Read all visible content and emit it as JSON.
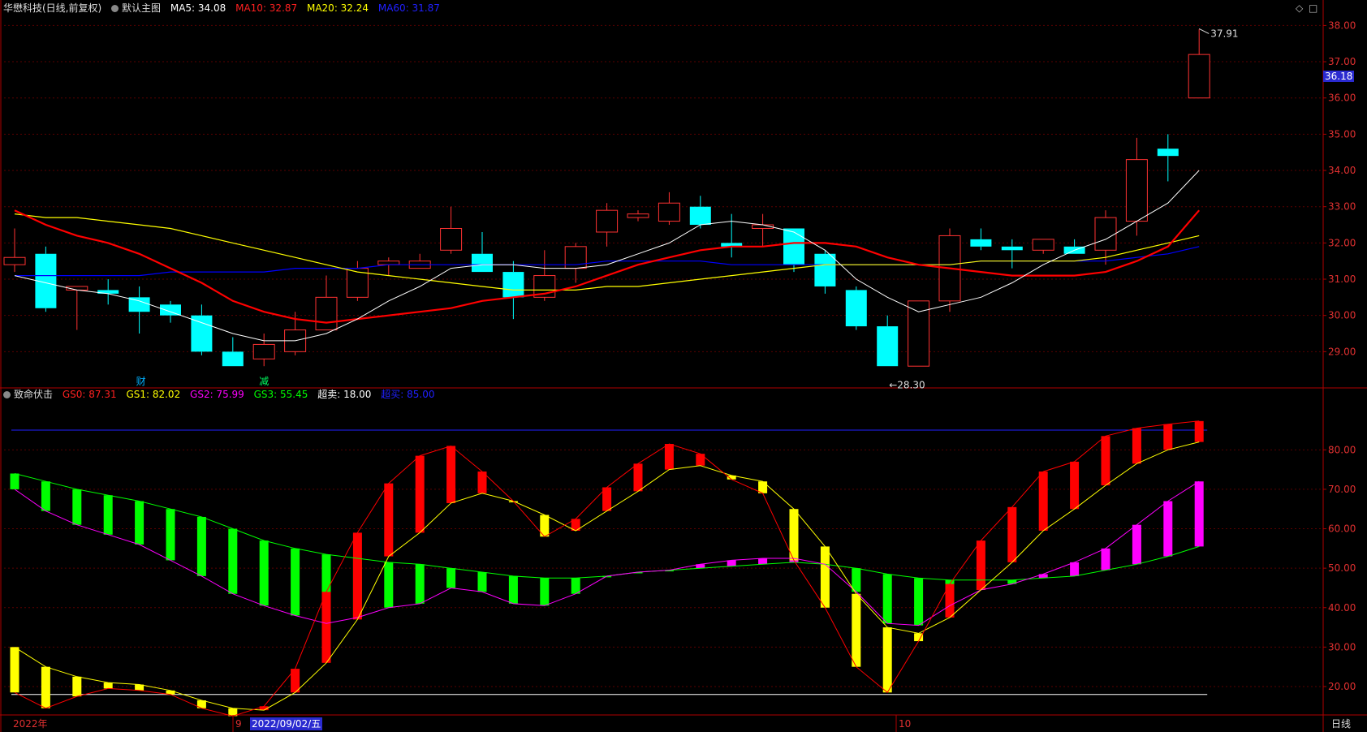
{
  "main_header": {
    "title": "华懋科技(日线,前复权)",
    "chart_name": "默认主图",
    "ma5_label": "MA5: 34.08",
    "ma10_label": "MA10: 32.87",
    "ma20_label": "MA20: 32.24",
    "ma60_label": "MA60: 31.87"
  },
  "sub_header": {
    "name": "致命伏击",
    "gs0_label": "GS0: 87.31",
    "gs1_label": "GS1: 82.02",
    "gs2_label": "GS2: 75.99",
    "gs3_label": "GS3: 55.45",
    "oversold_label": "超卖: 18.00",
    "overbought_label": "超买: 85.00"
  },
  "colors": {
    "up": "#ff3232",
    "down": "#00ffff",
    "ma5": "#ffffff",
    "ma10": "#ff0000",
    "ma20": "#ffff00",
    "ma60": "#0000ff",
    "gs_red": "#ff0000",
    "gs_yellow": "#ffff00",
    "gs_green": "#00ff00",
    "gs_magenta": "#ff00ff",
    "axis": "#b00000"
  },
  "annotations": {
    "high_label": "37.91",
    "low_label": "28.30",
    "current_price": "36.18",
    "event1": "财",
    "event2": "减"
  },
  "time_axis": {
    "year_label": "2022年",
    "sep_label": "9",
    "oct_label": "10",
    "cursor_date": "2022/09/02/五",
    "timeframe": "日线"
  },
  "chart_data": [
    {
      "type": "candlestick",
      "title": "华懋科技(日线,前复权)",
      "ylim": [
        28.0,
        38.3
      ],
      "y_ticks": [
        "29.00",
        "30.00",
        "31.00",
        "32.00",
        "33.00",
        "34.00",
        "35.00",
        "36.00",
        "37.00",
        "38.00"
      ],
      "candles": [
        {
          "o": 31.4,
          "h": 32.4,
          "l": 31.2,
          "c": 31.6
        },
        {
          "o": 31.7,
          "h": 31.9,
          "l": 30.1,
          "c": 30.2
        },
        {
          "o": 30.7,
          "h": 30.8,
          "l": 29.6,
          "c": 30.8
        },
        {
          "o": 30.7,
          "h": 31.0,
          "l": 30.3,
          "c": 30.6
        },
        {
          "o": 30.5,
          "h": 30.8,
          "l": 29.5,
          "c": 30.1
        },
        {
          "o": 30.3,
          "h": 30.4,
          "l": 29.8,
          "c": 30.0
        },
        {
          "o": 30.0,
          "h": 30.3,
          "l": 28.9,
          "c": 29.0
        },
        {
          "o": 29.0,
          "h": 29.4,
          "l": 28.6,
          "c": 28.6
        },
        {
          "o": 28.8,
          "h": 29.5,
          "l": 28.6,
          "c": 29.2
        },
        {
          "o": 29.0,
          "h": 30.1,
          "l": 28.9,
          "c": 29.6
        },
        {
          "o": 29.6,
          "h": 31.1,
          "l": 29.6,
          "c": 30.5
        },
        {
          "o": 30.5,
          "h": 31.5,
          "l": 30.4,
          "c": 31.3
        },
        {
          "o": 31.4,
          "h": 31.6,
          "l": 31.1,
          "c": 31.5
        },
        {
          "o": 31.3,
          "h": 31.7,
          "l": 31.3,
          "c": 31.5
        },
        {
          "o": 31.8,
          "h": 33.0,
          "l": 31.7,
          "c": 32.4
        },
        {
          "o": 31.7,
          "h": 32.3,
          "l": 31.2,
          "c": 31.2
        },
        {
          "o": 31.2,
          "h": 31.5,
          "l": 29.9,
          "c": 30.5
        },
        {
          "o": 30.5,
          "h": 31.8,
          "l": 30.4,
          "c": 31.1
        },
        {
          "o": 31.3,
          "h": 32.0,
          "l": 30.9,
          "c": 31.9
        },
        {
          "o": 32.3,
          "h": 33.1,
          "l": 31.9,
          "c": 32.9
        },
        {
          "o": 32.7,
          "h": 32.9,
          "l": 32.6,
          "c": 32.8
        },
        {
          "o": 32.6,
          "h": 33.4,
          "l": 32.5,
          "c": 33.1
        },
        {
          "o": 33.0,
          "h": 33.3,
          "l": 32.4,
          "c": 32.5
        },
        {
          "o": 32.0,
          "h": 32.8,
          "l": 31.6,
          "c": 31.9
        },
        {
          "o": 32.4,
          "h": 32.8,
          "l": 31.9,
          "c": 32.5
        },
        {
          "o": 32.4,
          "h": 32.4,
          "l": 31.2,
          "c": 31.4
        },
        {
          "o": 31.7,
          "h": 31.8,
          "l": 30.6,
          "c": 30.8
        },
        {
          "o": 30.7,
          "h": 30.8,
          "l": 29.6,
          "c": 29.7
        },
        {
          "o": 29.7,
          "h": 30.0,
          "l": 28.6,
          "c": 28.6
        },
        {
          "o": 28.6,
          "h": 30.4,
          "l": 28.6,
          "c": 30.4
        },
        {
          "o": 30.4,
          "h": 32.4,
          "l": 30.1,
          "c": 32.2
        },
        {
          "o": 32.1,
          "h": 32.4,
          "l": 31.8,
          "c": 31.9
        },
        {
          "o": 31.9,
          "h": 32.1,
          "l": 31.3,
          "c": 31.8
        },
        {
          "o": 31.8,
          "h": 32.1,
          "l": 31.7,
          "c": 32.1
        },
        {
          "o": 31.9,
          "h": 32.1,
          "l": 31.7,
          "c": 31.7
        },
        {
          "o": 31.8,
          "h": 32.9,
          "l": 31.4,
          "c": 32.7
        },
        {
          "o": 32.6,
          "h": 34.9,
          "l": 32.2,
          "c": 34.3
        },
        {
          "o": 34.6,
          "h": 35.0,
          "l": 33.7,
          "c": 34.4
        },
        {
          "o": 36.0,
          "h": 37.9,
          "l": 36.0,
          "c": 37.2
        }
      ],
      "ma5": [
        31.1,
        30.9,
        30.7,
        30.6,
        30.4,
        30.1,
        29.8,
        29.5,
        29.3,
        29.3,
        29.5,
        29.9,
        30.4,
        30.8,
        31.3,
        31.4,
        31.4,
        31.3,
        31.3,
        31.4,
        31.7,
        32.0,
        32.5,
        32.6,
        32.5,
        32.3,
        31.8,
        31.0,
        30.5,
        30.1,
        30.3,
        30.5,
        30.9,
        31.4,
        31.8,
        32.1,
        32.6,
        33.1,
        34.0
      ],
      "ma10": [
        32.9,
        32.5,
        32.2,
        32.0,
        31.7,
        31.3,
        30.9,
        30.4,
        30.1,
        29.9,
        29.8,
        29.9,
        30.0,
        30.1,
        30.2,
        30.4,
        30.5,
        30.6,
        30.8,
        31.1,
        31.4,
        31.6,
        31.8,
        31.9,
        31.9,
        32.0,
        32.0,
        31.9,
        31.6,
        31.4,
        31.3,
        31.2,
        31.1,
        31.1,
        31.1,
        31.2,
        31.5,
        31.9,
        32.9
      ],
      "ma20": [
        32.8,
        32.7,
        32.7,
        32.6,
        32.5,
        32.4,
        32.2,
        32.0,
        31.8,
        31.6,
        31.4,
        31.2,
        31.1,
        31.0,
        30.9,
        30.8,
        30.7,
        30.7,
        30.7,
        30.8,
        30.8,
        30.9,
        31.0,
        31.1,
        31.2,
        31.3,
        31.4,
        31.4,
        31.4,
        31.4,
        31.4,
        31.5,
        31.5,
        31.5,
        31.5,
        31.6,
        31.8,
        32.0,
        32.2
      ],
      "ma60": [
        31.1,
        31.1,
        31.1,
        31.1,
        31.1,
        31.2,
        31.2,
        31.2,
        31.2,
        31.3,
        31.3,
        31.3,
        31.4,
        31.4,
        31.4,
        31.4,
        31.4,
        31.4,
        31.4,
        31.5,
        31.5,
        31.5,
        31.5,
        31.4,
        31.4,
        31.4,
        31.4,
        31.4,
        31.4,
        31.4,
        31.4,
        31.5,
        31.5,
        31.5,
        31.5,
        31.5,
        31.6,
        31.7,
        31.9
      ]
    },
    {
      "type": "bar",
      "title": "致命伏击",
      "ylim": [
        13.0,
        92.0
      ],
      "y_ticks": [
        "20.00",
        "30.00",
        "40.00",
        "50.00",
        "60.00",
        "70.00",
        "80.00"
      ],
      "oversold": 18.0,
      "overbought": 85.0,
      "series": [
        {
          "name": "GS0",
          "values": [
            18.5,
            14.5,
            17.5,
            19.5,
            19.0,
            18.0,
            14.5,
            12.5,
            15.0,
            24.5,
            44.0,
            59.0,
            71.5,
            78.5,
            81.0,
            74.5,
            67.0,
            58.0,
            62.5,
            70.5,
            76.5,
            81.5,
            79.0,
            72.5,
            69.0,
            52.0,
            40.0,
            25.0,
            18.5,
            31.5,
            46.0,
            57.0,
            65.5,
            74.5,
            77.0,
            83.5,
            85.5,
            86.5,
            87.3
          ]
        },
        {
          "name": "GS1",
          "values": [
            30.0,
            25.0,
            22.5,
            21.0,
            20.5,
            19.0,
            16.5,
            14.5,
            14.0,
            18.5,
            26.0,
            37.0,
            53.0,
            59.0,
            66.5,
            69.0,
            67.0,
            63.5,
            59.5,
            64.5,
            69.5,
            75.0,
            76.0,
            73.5,
            72.0,
            65.0,
            55.5,
            43.5,
            35.0,
            33.5,
            37.5,
            44.5,
            51.5,
            59.5,
            65.0,
            71.0,
            76.5,
            80.0,
            82.0
          ]
        },
        {
          "name": "GS2",
          "values": [
            70.0,
            64.5,
            61.0,
            58.5,
            56.0,
            52.0,
            48.0,
            43.5,
            40.5,
            38.0,
            36.0,
            37.5,
            40.0,
            41.0,
            45.0,
            44.0,
            41.0,
            40.5,
            43.5,
            48.0,
            49.0,
            49.5,
            51.0,
            52.0,
            52.5,
            52.5,
            51.0,
            44.0,
            36.0,
            35.5,
            40.5,
            44.5,
            46.0,
            48.5,
            51.5,
            55.0,
            61.0,
            67.0,
            72.0
          ]
        },
        {
          "name": "GS3",
          "values": [
            74.0,
            72.0,
            70.0,
            68.5,
            67.0,
            65.0,
            63.0,
            60.0,
            57.0,
            55.0,
            53.5,
            52.5,
            51.5,
            51.0,
            50.0,
            49.0,
            48.0,
            47.5,
            47.5,
            48.0,
            49.0,
            49.5,
            50.0,
            50.5,
            51.0,
            51.5,
            51.0,
            50.0,
            48.5,
            47.5,
            47.0,
            47.0,
            47.0,
            47.5,
            48.0,
            49.5,
            51.0,
            53.0,
            55.5
          ]
        }
      ]
    }
  ]
}
